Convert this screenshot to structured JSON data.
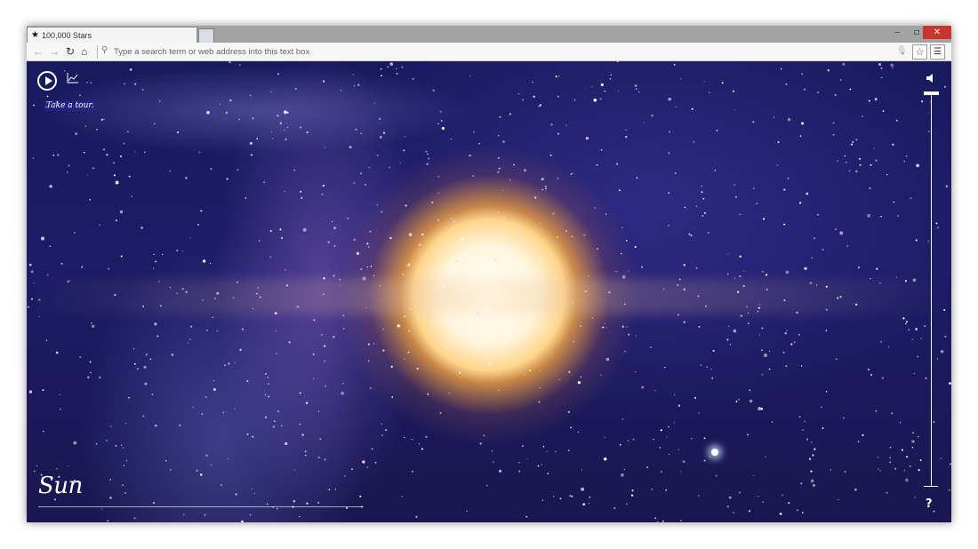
{
  "browser": {
    "tab_title": "100,000 Stars",
    "tab_icon": "star-icon",
    "window_controls": {
      "minimize": "‒",
      "restore": "▫",
      "close": "✕"
    },
    "address_placeholder": "Type a search term or web address into this text box",
    "nav_icons": [
      "back-icon",
      "forward-icon",
      "reload-icon",
      "home-icon"
    ]
  },
  "app": {
    "tour_label": "Take a tour.",
    "star_name": "Sun",
    "help_label": "?",
    "colors": {
      "space": "#1b1a60",
      "sun_core": "#fff6dd",
      "sun_glow": "#ffb65a",
      "ui": "#ffffff"
    }
  }
}
